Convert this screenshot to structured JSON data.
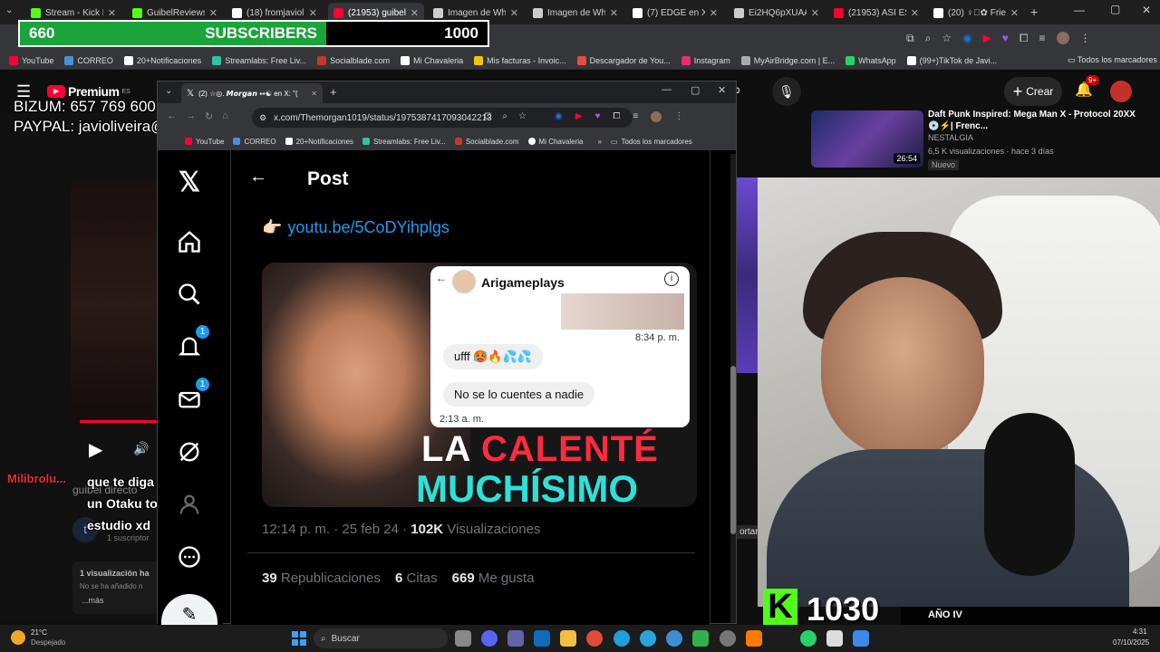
{
  "outer_tabs": [
    {
      "label": "Stream - Kick Dash",
      "color": "#53fc18"
    },
    {
      "label": "GuibelReviewsDir",
      "color": "#53fc18"
    },
    {
      "label": "(18) fromjaviolive",
      "color": "#ffffff"
    },
    {
      "label": "(21953) guibel dir",
      "color": "#ff0033"
    },
    {
      "label": "Imagen de Whats",
      "color": "#cccccc"
    },
    {
      "label": "Imagen de Whats",
      "color": "#cccccc"
    },
    {
      "label": "(7) EDGE en X: \"@",
      "color": "#ffffff"
    },
    {
      "label": "Ei2HQ6pXUAArZx",
      "color": "#cccccc"
    },
    {
      "label": "(21953) ASÍ ES GU",
      "color": "#ff0033"
    },
    {
      "label": "(20) ♀⃠✿ Friede",
      "color": "#ffffff"
    }
  ],
  "bookmarks": [
    {
      "label": "YouTube",
      "color": "#ff0033"
    },
    {
      "label": "CORREO",
      "color": "#4a90d9"
    },
    {
      "label": "20+Notificaciones",
      "color": "#ffffff"
    },
    {
      "label": "Streamlabs: Free Liv...",
      "color": "#31c3a2"
    },
    {
      "label": "Socialblade.com",
      "color": "#c0392b"
    },
    {
      "label": "Mi Chavaleria",
      "color": "#ffffff"
    },
    {
      "label": "Mis facturas - Invoic...",
      "color": "#f1c40f"
    },
    {
      "label": "Descargador de You...",
      "color": "#e74c3c"
    },
    {
      "label": "Instagram",
      "color": "#e1306c"
    },
    {
      "label": "MyAirBridge.com | E...",
      "color": "#aaaaaa"
    },
    {
      "label": "WhatsApp",
      "color": "#25d366"
    },
    {
      "label": "(99+)TikTok de Javi...",
      "color": "#ffffff"
    }
  ],
  "bookmarks_all": "Todos los marcadores",
  "subcounter": {
    "left": "660",
    "label": "SUBSCRIBERS",
    "goal": "1000"
  },
  "overlay": {
    "bizum": "BIZUM: 657 769 600",
    "paypal": "PAYPAL: javioliveira@live.com"
  },
  "youtube": {
    "logo": "Premium",
    "region": "ES",
    "create": "Crear",
    "notif_badge": "9+",
    "rec_title": "Daft Punk Inspired: Mega Man X - Protocol 20XX 💿⚡| Frenc...",
    "rec_channel": "NESTALGIA",
    "rec_meta": "6,5 K visualizaciones · hace 3 días",
    "rec_badge": "Nuevo",
    "rec_duration": "26:54",
    "channel_name": "guibel directo",
    "subscribers": "1 suscriptor",
    "views": "1 visualización  ha",
    "desc": "No se ha añadido n",
    "more": "...más",
    "share": "ortar"
  },
  "chat": {
    "user": "Milibrolu...",
    "message": "que te diga la novia de un Otaku tonto es de estudio xd"
  },
  "inner_browser": {
    "tab_label": "(2) ☆◎. 𝙈𝙤𝙧𝙜𝙖𝙣 ↭☯ en X: \"(",
    "url": "x.com/Themorgan1019/status/1975387417093042213",
    "bookmarks": [
      "YouTube",
      "CORREO",
      "20+Notificaciones",
      "Streamlabs: Free Liv...",
      "Socialblade.com",
      "Mi Chavaleria"
    ],
    "bookmarks_all": "Todos los marcadores"
  },
  "x_post": {
    "header": "Post",
    "link": "youtu.be/5CoDYihplgs",
    "notif_count": "1",
    "msg_count": "1",
    "thumb": {
      "dm_name": "Arigameplays",
      "time1": "8:34 p. m.",
      "msg1": "ufff 🥵🔥💦💦",
      "msg2": "No se lo cuentes a nadie",
      "time2": "2:13 a. m.",
      "headline1a": "LA ",
      "headline1b": "CALENTÉ",
      "headline2": "MUCHÍSIMO"
    },
    "timestamp": "12:14 p. m. · 25 feb 24 · ",
    "views_num": "102K",
    "views_label": " Visualizaciones",
    "reposts_num": "39",
    "reposts_label": "Republicaciones",
    "quotes_num": "6",
    "quotes_label": "Citas",
    "likes_num": "669",
    "likes_label": "Me gusta"
  },
  "kick_overlay": {
    "count": "1030",
    "label": "AÑO IV"
  },
  "taskbar": {
    "weather_temp": "21°C",
    "weather_desc": "Despejado",
    "search": "Buscar",
    "time": "4:31",
    "date": "07/10/2025"
  }
}
